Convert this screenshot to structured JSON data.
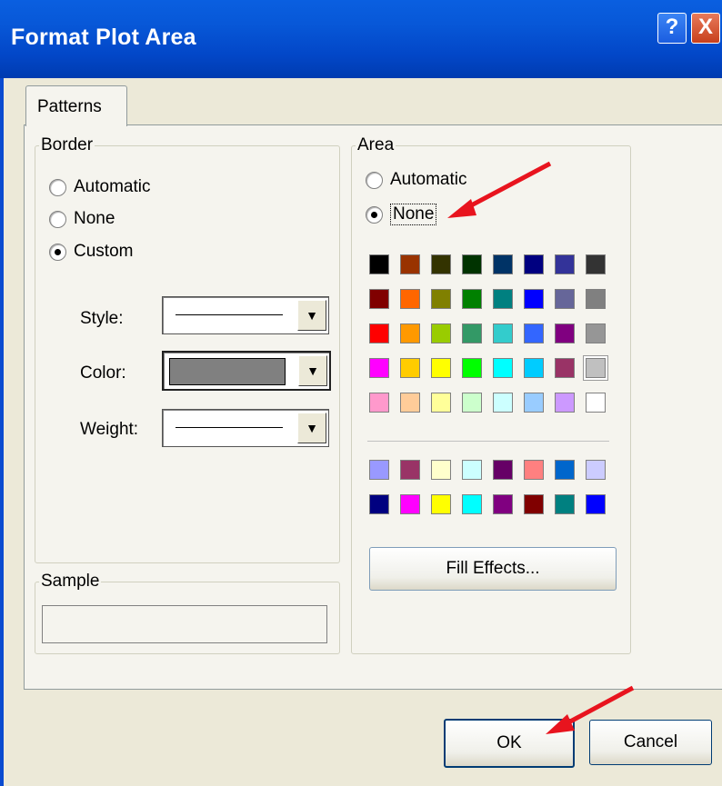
{
  "window": {
    "title": "Format Plot Area",
    "help_label": "?",
    "close_label": "X"
  },
  "tabs": [
    {
      "label": "Patterns"
    }
  ],
  "border": {
    "legend": "Border",
    "options": [
      {
        "label": "Automatic",
        "checked": false
      },
      {
        "label": "None",
        "checked": false
      },
      {
        "label": "Custom",
        "checked": true
      }
    ],
    "style_label": "Style:",
    "color_label": "Color:",
    "weight_label": "Weight:",
    "color_value": "#808080",
    "dropdown_arrow": "▼"
  },
  "sample": {
    "legend": "Sample"
  },
  "area": {
    "legend": "Area",
    "options": [
      {
        "label": "Automatic",
        "checked": false
      },
      {
        "label": "None",
        "checked": true
      }
    ],
    "palette_main": [
      [
        "#000000",
        "#993300",
        "#333300",
        "#003300",
        "#003366",
        "#000080",
        "#333399",
        "#333333"
      ],
      [
        "#800000",
        "#FF6600",
        "#808000",
        "#008000",
        "#008080",
        "#0000FF",
        "#666699",
        "#808080"
      ],
      [
        "#FF0000",
        "#FF9900",
        "#99CC00",
        "#339966",
        "#33CCCC",
        "#3366FF",
        "#800080",
        "#969696"
      ],
      [
        "#FF00FF",
        "#FFCC00",
        "#FFFF00",
        "#00FF00",
        "#00FFFF",
        "#00CCFF",
        "#993366",
        "#C0C0C0"
      ],
      [
        "#FF99CC",
        "#FFCC99",
        "#FFFF99",
        "#CCFFCC",
        "#CCFFFF",
        "#99CCFF",
        "#CC99FF",
        "#FFFFFF"
      ]
    ],
    "palette_extra": [
      [
        "#9999FF",
        "#993366",
        "#FFFFCC",
        "#CCFFFF",
        "#660066",
        "#FF8080",
        "#0066CC",
        "#CCCCFF"
      ],
      [
        "#000080",
        "#FF00FF",
        "#FFFF00",
        "#00FFFF",
        "#800080",
        "#800000",
        "#008080",
        "#0000FF"
      ]
    ],
    "fill_effects_label": "Fill Effects..."
  },
  "buttons": {
    "ok_label": "OK",
    "cancel_label": "Cancel"
  },
  "annotation_color": "#E8141E"
}
